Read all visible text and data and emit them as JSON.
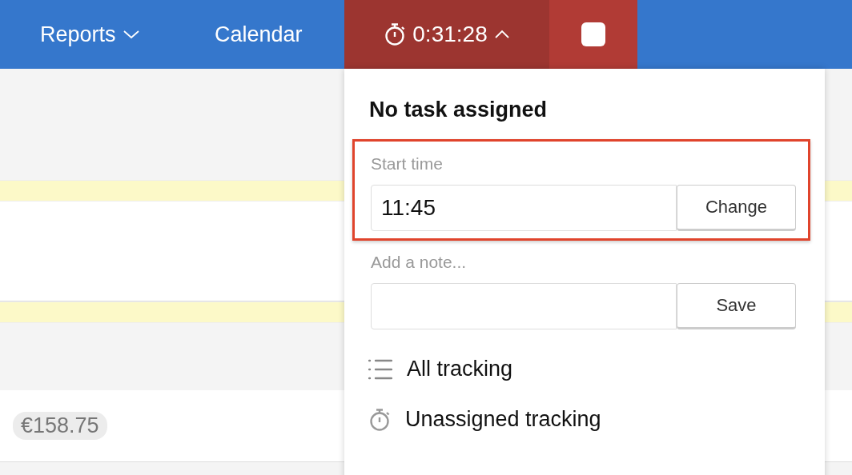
{
  "nav": [
    {
      "label": "Reports",
      "kind": "dropdown"
    },
    {
      "label": "Calendar",
      "kind": "link"
    }
  ],
  "timer": {
    "time": "0:31:28",
    "expanded": true
  },
  "popup": {
    "title": "No task assigned",
    "highlighted": true,
    "start_time": {
      "label": "Start time",
      "value": "11:45",
      "button": "Change"
    },
    "note": {
      "label": "Add a note...",
      "button": "Save"
    },
    "links": [
      {
        "label": "All tracking",
        "kind": "list"
      },
      {
        "label": "Unassigned tracking",
        "kind": "timer"
      }
    ]
  },
  "amount": "€158.75"
}
